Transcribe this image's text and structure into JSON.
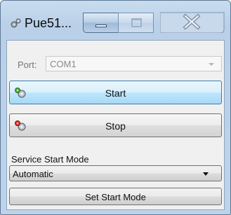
{
  "window": {
    "title": "Pue51...",
    "app_icon": "service-gear-icon",
    "minimize_icon": "minimize-icon",
    "maximize_icon": "maximize-icon",
    "close_icon": "close-icon"
  },
  "port": {
    "label": "Port:",
    "value": "COM1",
    "enabled": false
  },
  "buttons": {
    "start_label": "Start",
    "start_icon": "green-gear-icon",
    "stop_label": "Stop",
    "stop_icon": "red-gear-icon"
  },
  "service_mode": {
    "label": "Service Start Mode",
    "selected": "Automatic",
    "set_label": "Set Start Mode"
  },
  "colors": {
    "frame": "#bcd3ea",
    "start_accent": "#3c7fb1",
    "start_gear": "#4caf3a",
    "stop_gear": "#d9312a"
  }
}
